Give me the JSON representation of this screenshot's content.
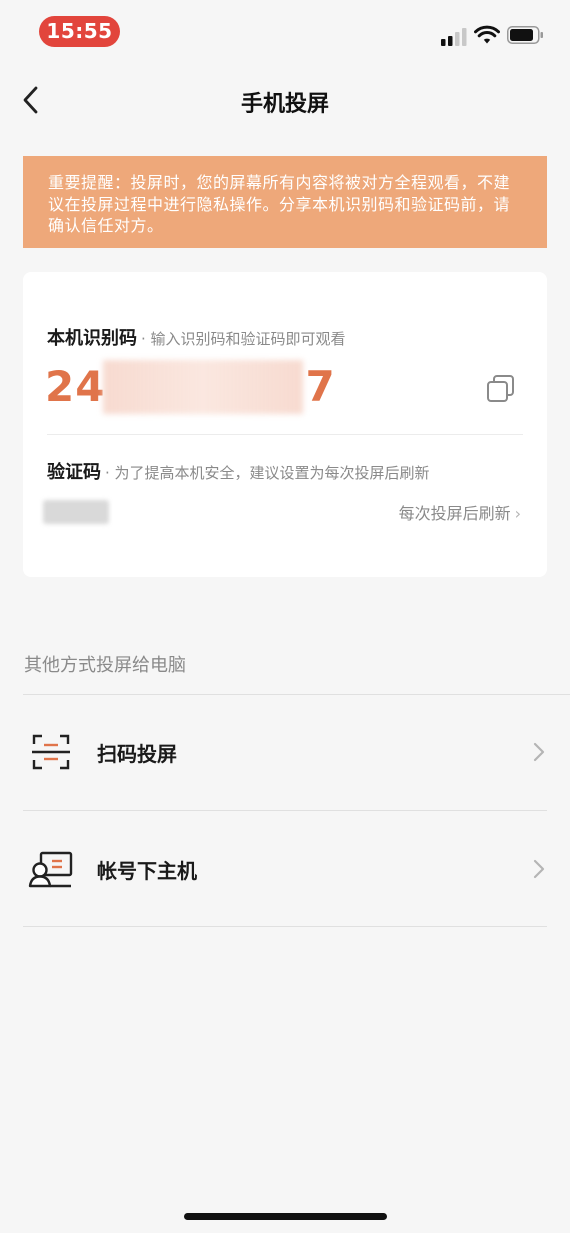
{
  "status_bar": {
    "time": "15:55",
    "signal_icon": "cellular-signal-icon",
    "wifi_icon": "wifi-icon",
    "battery_icon": "battery-icon"
  },
  "nav": {
    "title": "手机投屏",
    "back_icon": "chevron-left-icon"
  },
  "warning": {
    "text": "重要提醒：投屏时，您的屏幕所有内容将被对方全程观看，不建议在投屏过程中进行隐私操作。分享本机识别码和验证码前，请确认信任对方。"
  },
  "device_code": {
    "label": "本机识别码",
    "hint": "· 输入识别码和验证码即可观看",
    "value_start": "24",
    "value_end": "7",
    "copy_icon": "copy-icon"
  },
  "verify_code": {
    "label": "验证码",
    "hint": "· 为了提高本机安全，建议设置为每次投屏后刷新",
    "refresh_option": "每次投屏后刷新"
  },
  "other_methods": {
    "title": "其他方式投屏给电脑",
    "items": [
      {
        "label": "扫码投屏",
        "icon": "scan-icon"
      },
      {
        "label": "帐号下主机",
        "icon": "computer-user-icon"
      }
    ]
  },
  "colors": {
    "accent": "#e0744a",
    "warning_bg": "#eea87a",
    "time_pill": "#e2453c"
  }
}
